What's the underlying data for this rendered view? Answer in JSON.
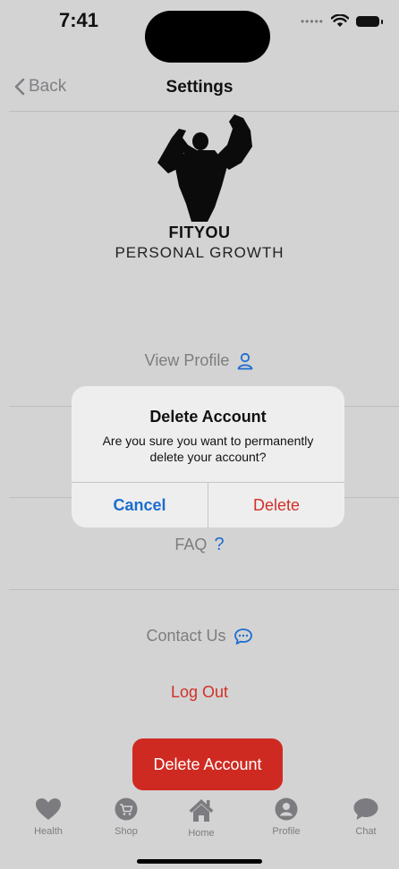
{
  "status_bar": {
    "time": "7:41"
  },
  "nav": {
    "back_label": "Back",
    "title": "Settings"
  },
  "brand": {
    "name": "FITYOU",
    "tagline": "PERSONAL GROWTH"
  },
  "menu": {
    "view_profile": "View Profile",
    "faq": "FAQ",
    "contact_us": "Contact Us",
    "log_out": "Log Out",
    "delete_account": "Delete Account"
  },
  "alert": {
    "title": "Delete Account",
    "message": "Are you sure you want to permanently delete your account?",
    "cancel": "Cancel",
    "delete": "Delete"
  },
  "tabs": [
    {
      "label": "Health",
      "icon": "heart-icon"
    },
    {
      "label": "Shop",
      "icon": "cart-icon"
    },
    {
      "label": "Home",
      "icon": "home-icon"
    },
    {
      "label": "Profile",
      "icon": "user-icon"
    },
    {
      "label": "Chat",
      "icon": "chat-bubble-icon"
    }
  ],
  "colors": {
    "accent_blue": "#1c6dd0",
    "destructive_red": "#d23028",
    "background": "#d3d3d3"
  }
}
